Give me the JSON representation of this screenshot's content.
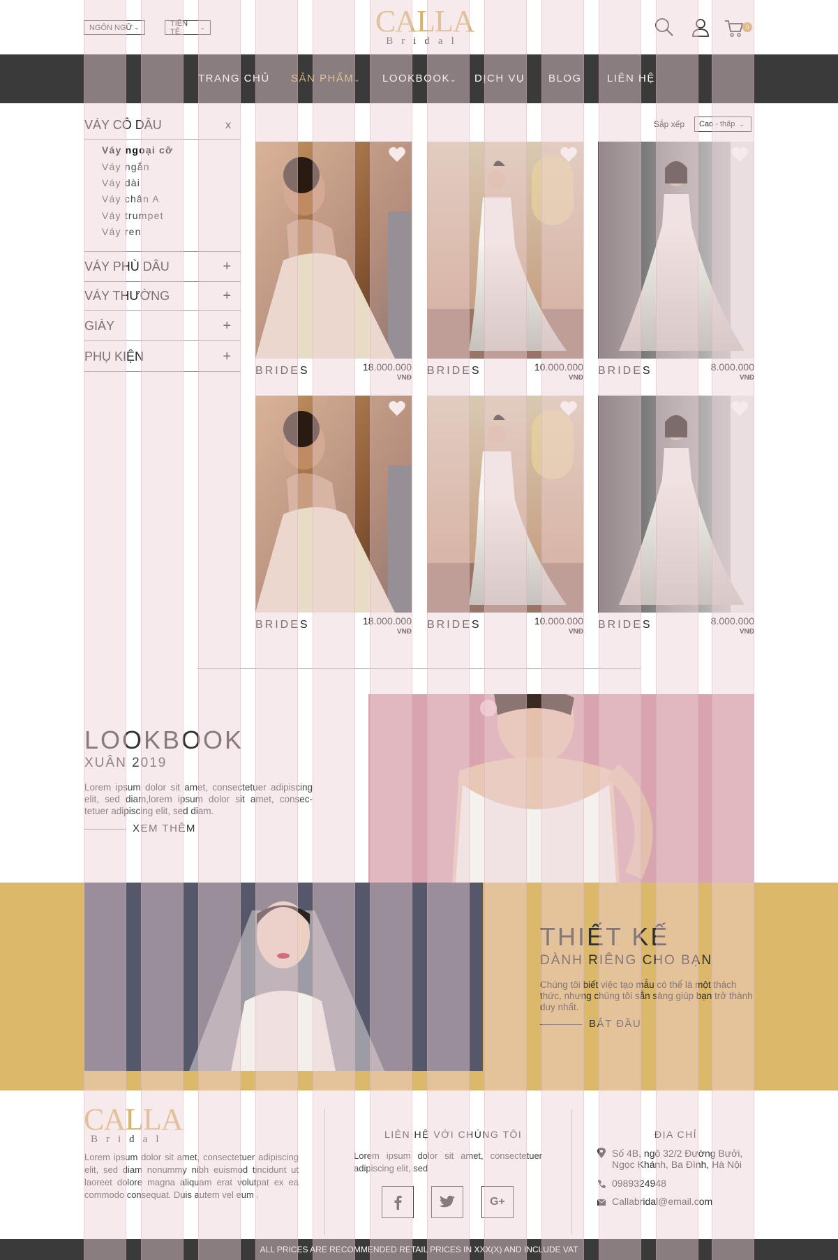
{
  "header": {
    "language_label": "NGÔN NGỮ",
    "currency_label": "TIỀN TỆ",
    "logo_word": "CALLA",
    "logo_sub": "Bridal",
    "cart_count": "0"
  },
  "nav": {
    "items": [
      {
        "label": "TRANG CHỦ"
      },
      {
        "label": "SẢN PHẨM"
      },
      {
        "label": "LOOKBOOK"
      },
      {
        "label": "DỊCH VỤ"
      },
      {
        "label": "BLOG"
      },
      {
        "label": "LIÊN HỆ"
      }
    ],
    "active": "SẢN PHẨM"
  },
  "sidebar": {
    "categories": [
      {
        "label": "VÁY CÔ DÂU",
        "sign": "x"
      },
      {
        "label": "VÁY PHÙ DÂU",
        "sign": "+"
      },
      {
        "label": "VÁY THƯỜNG",
        "sign": "+"
      },
      {
        "label": "GIÀY",
        "sign": "+"
      },
      {
        "label": "PHỤ KIỆN",
        "sign": "+"
      }
    ],
    "subcategories": [
      {
        "label": "Váy ngoại cỡ"
      },
      {
        "label": "Váy ngắn"
      },
      {
        "label": "Váy dài"
      },
      {
        "label": "Váy chân A"
      },
      {
        "label": "Váy trumpet"
      },
      {
        "label": "Váy ren"
      }
    ]
  },
  "sort": {
    "label": "Sắp xếp",
    "value": "Cao - thấp"
  },
  "products": [
    {
      "name": "BRIDES",
      "price": "18.000.000",
      "currency": "VNĐ"
    },
    {
      "name": "BRIDES",
      "price": "10.000.000",
      "currency": "VNĐ"
    },
    {
      "name": "BRIDES",
      "price": "8.000.000",
      "currency": "VNĐ"
    },
    {
      "name": "BRIDES",
      "price": "18.000.000",
      "currency": "VNĐ"
    },
    {
      "name": "BRIDES",
      "price": "10.000.000",
      "currency": "VNĐ"
    },
    {
      "name": "BRIDES",
      "price": "8.000.000",
      "currency": "VNĐ"
    }
  ],
  "lookbook": {
    "title": "LOOKBOOK",
    "subtitle": "XUÂN 2019",
    "text": "Lorem ipsum dolor sit amet, consectetuer adipiscing elit, sed diam,lorem ipsum dolor sit amet, consec-tetuer adipiscing elit, sed diam.",
    "more": "XEM THÊM"
  },
  "design": {
    "title": "THIẾT KẾ",
    "subtitle": "DÀNH RIÊNG CHO BẠN",
    "text": "Chúng tôi biết việc tạo mẫu có thể là một thách thức, nhưng chúng tôi sẵn sàng giúp bạn trở thành duy nhất.",
    "button": "BẮT ĐẦU"
  },
  "footer": {
    "about": "Lorem ipsum dolor sit amet, consectetuer adipiscing elit, sed diam nonummy nibh euismod tincidunt ut laoreet dolore magna aliquam erat volutpat ex ea commodo consequat. Duis autem vel eum .",
    "contact_heading": "LIÊN HỆ VỚI CHÚNG TÔI",
    "contact_text": "Lorem ipsum dolor sit amet, consectetuer adipiscing elit, sed",
    "address_heading": "ĐỊA CHỈ",
    "address_line1": "Số 4B, ngõ 32/2 Đường Bưởi,",
    "address_line2": "Ngọc Khánh, Ba Đình, Hà Nội",
    "phone": "0989324948",
    "email": "Callabridal@email.com",
    "social": [
      "facebook-icon",
      "twitter-icon",
      "google-plus-icon"
    ],
    "bottom_notice": "ALL PRICES ARE RECOMMENDED RETAIL PRICES IN XXX(X) AND INCLUDE VAT"
  },
  "colors": {
    "accent_gold": "#dcb86a",
    "nav_dark": "#3a3a3a",
    "grid_pink": "#eed0d4"
  }
}
